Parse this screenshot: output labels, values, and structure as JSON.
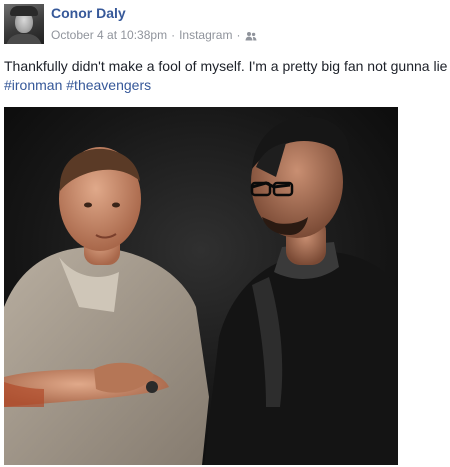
{
  "post": {
    "author": "Conor Daly",
    "date": "October 4 at 10:38pm",
    "meta_separator": "·",
    "source": "Instagram",
    "audience_icon": "friends-icon",
    "caption_text": "Thankfully didn't make a fool of myself. I'm a pretty big fan not gunna lie",
    "hashtags": [
      "#ironman",
      "#theavengers"
    ]
  },
  "colors": {
    "link": "#365899",
    "meta": "#90949c",
    "text": "#1d2129"
  }
}
